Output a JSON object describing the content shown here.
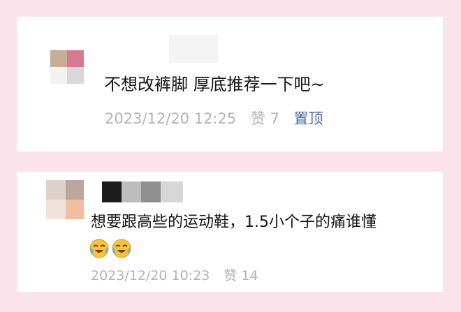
{
  "comments": [
    {
      "text": "不想改裤脚 厚底推荐一下吧~",
      "time": "2023/12/20 12:25",
      "likes": "赞 7",
      "pin_label": "置顶"
    },
    {
      "text": "想要跟高些的运动鞋，1.5小个子的痛谁懂",
      "emojis": [
        "laughing-crying-emoji",
        "laughing-crying-emoji"
      ],
      "time": "2023/12/20 10:23",
      "likes": "赞 14"
    }
  ],
  "colors": {
    "background": "#fbe3ec",
    "card": "#ffffff",
    "meta_text": "#b3b3b3",
    "pin_link": "#4d6c9f"
  }
}
